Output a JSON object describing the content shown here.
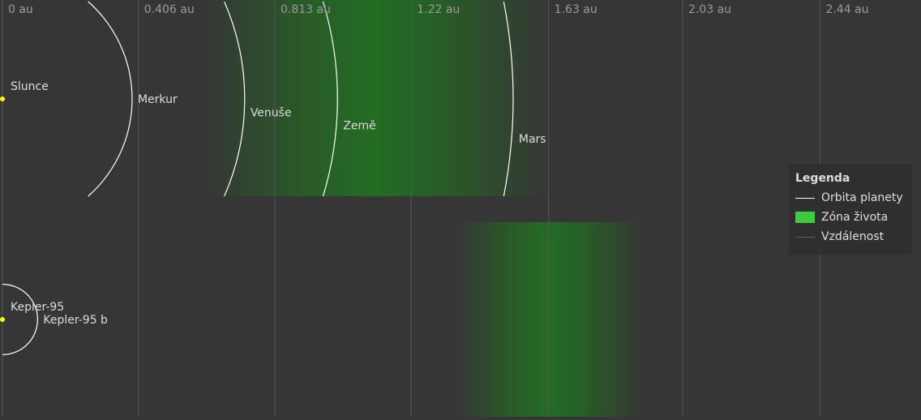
{
  "axis": {
    "ticks": [
      "0 au",
      "0.406 au",
      "0.813 au",
      "1.22 au",
      "1.63 au",
      "2.03 au",
      "2.44 au"
    ],
    "tick_values": [
      0,
      0.406,
      0.813,
      1.22,
      1.63,
      2.03,
      2.44
    ]
  },
  "systems": [
    {
      "star": "Slunce",
      "star_color": "#ffff00",
      "planets": [
        {
          "name": "Merkur",
          "a": 0.387
        },
        {
          "name": "Venuše",
          "a": 0.723
        },
        {
          "name": "Země",
          "a": 1.0
        },
        {
          "name": "Mars",
          "a": 1.524
        }
      ],
      "habitable_zone": {
        "inner": 0.6,
        "outer": 1.63
      }
    },
    {
      "star": "Kepler-95",
      "star_color": "#ffff00",
      "planets": [
        {
          "name": "Kepler-95 b",
          "a": 0.105
        }
      ],
      "habitable_zone": {
        "inner": 1.35,
        "outer": 1.91
      }
    }
  ],
  "legend": {
    "title": "Legenda",
    "items": [
      {
        "label": "Orbita planety"
      },
      {
        "label": "Zóna života"
      },
      {
        "label": "Vzdálenost"
      }
    ]
  },
  "colors": {
    "background": "#363636",
    "gridline": "#555555",
    "orbit": "#ffffff",
    "habitable_zone": "#1e7a1e",
    "star": "#ffff00"
  }
}
